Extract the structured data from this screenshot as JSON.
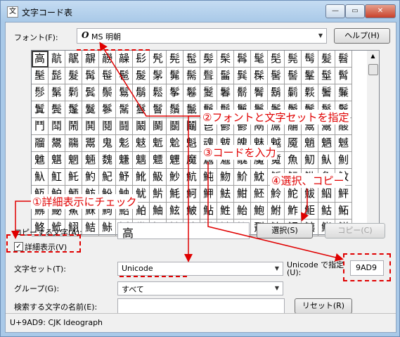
{
  "window": {
    "title": "文字コード表",
    "minimize_label": "—",
    "maximize_label": "▭",
    "close_label": "✕"
  },
  "font": {
    "label": "フォント(F):",
    "glyph": "O",
    "value": "MS 明朝",
    "help_button": "ヘルプ(H)"
  },
  "grid": {
    "rows": [
      [
        "高",
        "髚",
        "髛",
        "髜",
        "髝",
        "髞",
        "髟",
        "髠",
        "髡",
        "髢",
        "髣",
        "髤",
        "髥",
        "髦",
        "髧",
        "髨",
        "髩",
        "髪",
        "髫"
      ],
      [
        "髬",
        "髭",
        "髮",
        "髯",
        "髰",
        "髱",
        "髲",
        "髳",
        "髴",
        "髵",
        "髶",
        "髷",
        "髸",
        "髹",
        "髺",
        "髻",
        "髼",
        "髽",
        "髾"
      ],
      [
        "髿",
        "鬀",
        "鬁",
        "鬂",
        "鬃",
        "鬄",
        "鬅",
        "鬆",
        "鬇",
        "鬈",
        "鬉",
        "鬊",
        "鬋",
        "鬌",
        "鬍",
        "鬎",
        "鬏",
        "鬐",
        "鬑"
      ],
      [
        "鬒",
        "鬓",
        "鬔",
        "鬕",
        "鬖",
        "鬗",
        "鬘",
        "鬙",
        "鬚",
        "鬛",
        "鬜",
        "鬝",
        "鬞",
        "鬟",
        "鬠",
        "鬡",
        "鬢",
        "鬣",
        "鬤"
      ],
      [
        "鬥",
        "鬦",
        "鬧",
        "鬨",
        "鬩",
        "鬪",
        "鬫",
        "鬬",
        "鬭",
        "鬮",
        "鬯",
        "鬰",
        "鬱",
        "鬲",
        "鬳",
        "鬴",
        "鬵",
        "鬶",
        "鬷"
      ],
      [
        "鬸",
        "鬹",
        "鬺",
        "鬻",
        "鬼",
        "鬽",
        "鬾",
        "鬿",
        "魀",
        "魁",
        "魂",
        "魃",
        "魄",
        "魅",
        "魆",
        "魇",
        "魈",
        "魉",
        "魊"
      ],
      [
        "魋",
        "魌",
        "魍",
        "魎",
        "魏",
        "魐",
        "魑",
        "魒",
        "魓",
        "魔",
        "魕",
        "魖",
        "魗",
        "魘",
        "魙",
        "魚",
        "魛",
        "魜",
        "魝"
      ],
      [
        "魞",
        "魟",
        "魠",
        "魡",
        "魢",
        "魣",
        "魤",
        "魥",
        "魦",
        "魧",
        "魨",
        "魩",
        "魪",
        "魫",
        "魬",
        "魭",
        "魮",
        "魯",
        "魰"
      ],
      [
        "魱",
        "魲",
        "魳",
        "魴",
        "魵",
        "魶",
        "魷",
        "魸",
        "魹",
        "魺",
        "魻",
        "魼",
        "魽",
        "魾",
        "魿",
        "鮀",
        "鮁",
        "鮂",
        "鮃"
      ],
      [
        "鮄",
        "鮅",
        "鮆",
        "鮇",
        "鮈",
        "鮉",
        "鮊",
        "鮋",
        "鮌",
        "鮍",
        "鮎",
        "鮏",
        "鮐",
        "鮑",
        "鮒",
        "鮓",
        "鮔",
        "鮕",
        "鮖"
      ],
      [
        "鮗",
        "鮘",
        "鮙",
        "鮚",
        "鮛",
        "鮜",
        "鮝",
        "鮞",
        "鮟",
        "鮠",
        "鮡",
        "鮢",
        "鮣",
        "鮤",
        "鮥",
        "鮦",
        "鮧",
        "鮨",
        "鮩"
      ]
    ]
  },
  "copy": {
    "label": "コピーする文字(A):",
    "value": "高",
    "select_button": "選択(S)",
    "copy_button": "コピー(C)"
  },
  "advanced": {
    "label": "詳細表示(V)",
    "checked": true
  },
  "charset": {
    "label": "文字セット(T):",
    "value": "Unicode",
    "goto_label_line1": "Unicode で指定",
    "goto_label_line2": "(U):",
    "goto_value": "9AD9"
  },
  "group": {
    "label": "グループ(G):",
    "value": "すべて"
  },
  "search": {
    "label": "検索する文字の名前(E):",
    "value": "",
    "reset_button": "リセット(R)"
  },
  "status": {
    "text": "U+9AD9: CJK Ideograph"
  },
  "annotations": {
    "step1": "①詳細表示にチェック",
    "step2": "②フォントと文字セットを指定",
    "step3": "③コードを入力",
    "step4": "④選択、コピー",
    "color": "#e00000"
  }
}
